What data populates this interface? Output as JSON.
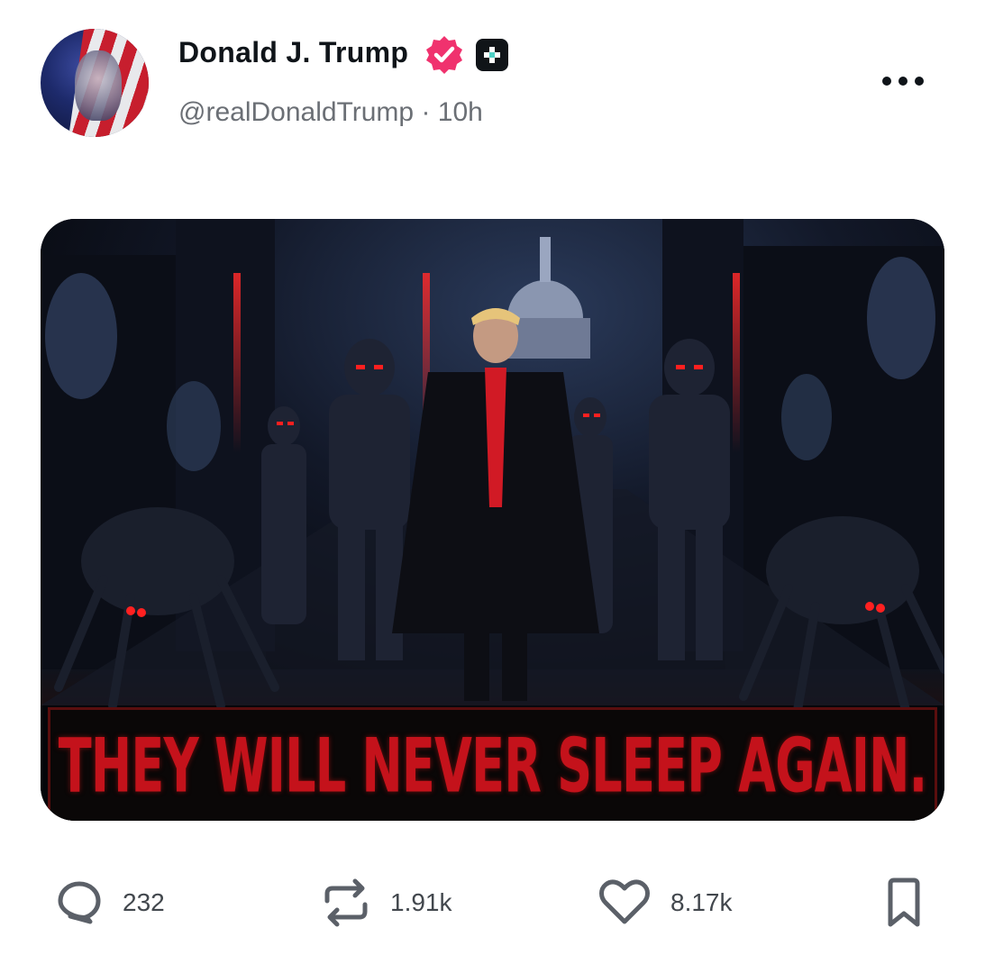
{
  "post": {
    "author_name": "Donald J. Trump",
    "handle": "@realDonaldTrump",
    "separator": "·",
    "time": "10h",
    "image_caption": "THEY WILL NEVER SLEEP AGAIN."
  },
  "actions": {
    "replies": "232",
    "reposts": "1.91k",
    "likes": "8.17k"
  },
  "icons": {
    "verified": "verified-badge-icon",
    "plus": "plus-badge-icon",
    "more": "more-dots-icon",
    "reply": "reply-icon",
    "repost": "repost-icon",
    "like": "heart-icon",
    "bookmark": "bookmark-icon"
  },
  "colors": {
    "verified": "#f0326e",
    "text": "#0f1419",
    "muted": "#6b6f75",
    "banner_red": "#c4121b"
  }
}
